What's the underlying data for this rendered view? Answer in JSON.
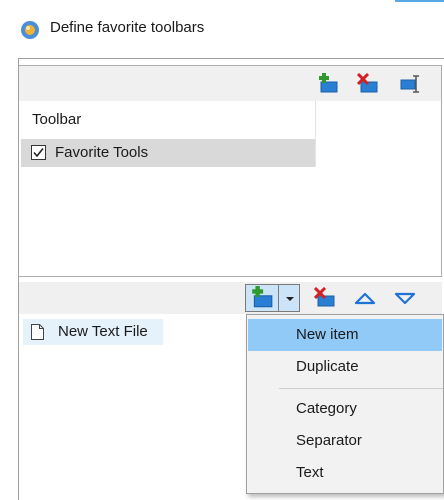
{
  "window": {
    "title": "Define favorite toolbars",
    "icon": "app-globe-icon"
  },
  "toolbar_actions": [
    {
      "name": "add-toolbar-button",
      "icon": "add-green-plus-icon"
    },
    {
      "name": "delete-toolbar-button",
      "icon": "delete-red-x-icon"
    },
    {
      "name": "rename-toolbar-button",
      "icon": "rename-cursor-icon"
    }
  ],
  "toolbars": {
    "column_header": "Toolbar",
    "rows": [
      {
        "label": "Favorite Tools",
        "checked": true,
        "selected": true
      }
    ]
  },
  "items_actions": [
    {
      "name": "add-item-split-button",
      "icon": "add-green-plus-icon"
    },
    {
      "name": "add-item-dropdown-arrow",
      "icon": "chevron-down-icon"
    },
    {
      "name": "delete-item-button",
      "icon": "delete-red-x-icon"
    },
    {
      "name": "move-up-button",
      "icon": "triangle-up-icon"
    },
    {
      "name": "move-down-button",
      "icon": "triangle-down-icon"
    }
  ],
  "items": {
    "rows": [
      {
        "label": "New Text File",
        "icon": "file-icon"
      }
    ]
  },
  "dropdown_menu": {
    "items": [
      {
        "label": "New item",
        "highlighted": true
      },
      {
        "label": "Duplicate",
        "highlighted": false
      },
      {
        "label": "Category",
        "highlighted": false
      },
      {
        "label": "Separator",
        "highlighted": false
      },
      {
        "label": "Text",
        "highlighted": false
      }
    ]
  },
  "colors": {
    "accent_blue": "#1e73d8",
    "add_green": "#2e9a2e",
    "delete_red": "#d42020",
    "menu_highlight": "#91c9f7",
    "selected_row": "#d9d9d9"
  }
}
